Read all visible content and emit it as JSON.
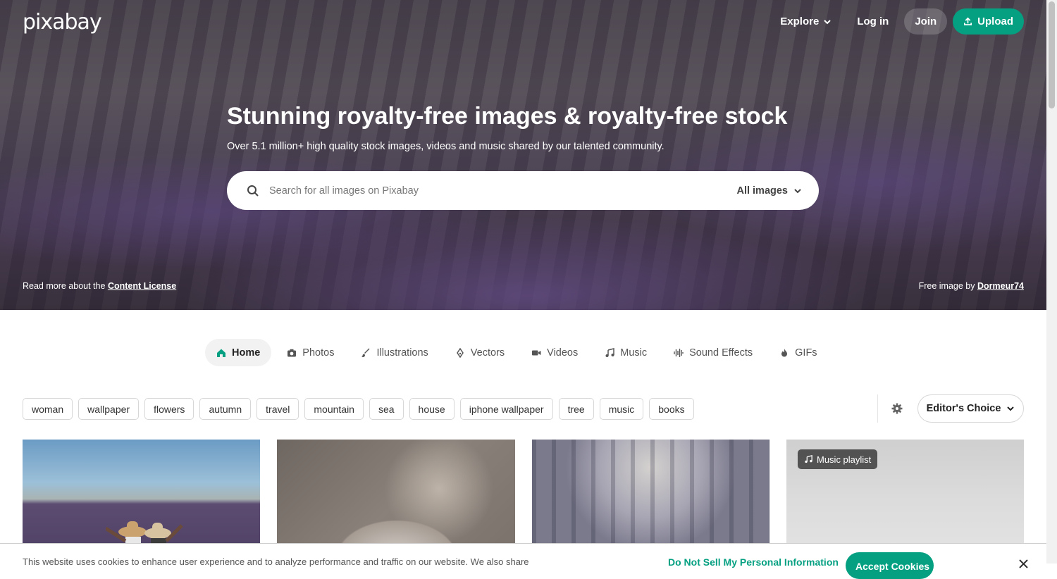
{
  "header": {
    "logo": "pixabay",
    "explore": "Explore",
    "login": "Log in",
    "join": "Join",
    "upload": "Upload"
  },
  "hero": {
    "title": "Stunning royalty-free images & royalty-free stock",
    "subtitle": "Over 5.1 million+ high quality stock images, videos and music shared by our talented community.",
    "search_placeholder": "Search for all images on Pixabay",
    "scope": "All images",
    "license_prefix": "Read more about the",
    "license_link": "Content License",
    "credit_prefix": "Free image by",
    "credit_author": "Dormeur74"
  },
  "tabs": [
    {
      "label": "Home",
      "icon": "home-icon"
    },
    {
      "label": "Photos",
      "icon": "camera-icon"
    },
    {
      "label": "Illustrations",
      "icon": "brush-icon"
    },
    {
      "label": "Vectors",
      "icon": "pen-nib-icon"
    },
    {
      "label": "Videos",
      "icon": "video-icon"
    },
    {
      "label": "Music",
      "icon": "music-icon"
    },
    {
      "label": "Sound Effects",
      "icon": "waveform-icon"
    },
    {
      "label": "GIFs",
      "icon": "fire-icon"
    }
  ],
  "tags": [
    "woman",
    "wallpaper",
    "flowers",
    "autumn",
    "travel",
    "mountain",
    "sea",
    "house",
    "iphone wallpaper",
    "tree",
    "music",
    "books"
  ],
  "sort": "Editor's Choice",
  "grid": {
    "music_badge": "Music playlist"
  },
  "cookie": {
    "text": "This website uses cookies to enhance user experience and to analyze performance and traffic on our website. We also share",
    "do_not_sell": "Do Not Sell My Personal Information",
    "accept": "Accept Cookies"
  },
  "colors": {
    "accent": "#05a081"
  }
}
